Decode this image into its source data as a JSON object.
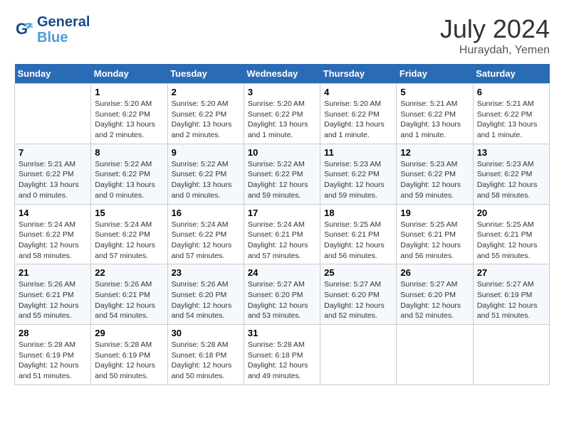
{
  "header": {
    "logo_line1": "General",
    "logo_line2": "Blue",
    "month": "July 2024",
    "location": "Huraydah, Yemen"
  },
  "columns": [
    "Sunday",
    "Monday",
    "Tuesday",
    "Wednesday",
    "Thursday",
    "Friday",
    "Saturday"
  ],
  "weeks": [
    [
      {
        "day": "",
        "info": ""
      },
      {
        "day": "1",
        "info": "Sunrise: 5:20 AM\nSunset: 6:22 PM\nDaylight: 13 hours\nand 2 minutes."
      },
      {
        "day": "2",
        "info": "Sunrise: 5:20 AM\nSunset: 6:22 PM\nDaylight: 13 hours\nand 2 minutes."
      },
      {
        "day": "3",
        "info": "Sunrise: 5:20 AM\nSunset: 6:22 PM\nDaylight: 13 hours\nand 1 minute."
      },
      {
        "day": "4",
        "info": "Sunrise: 5:20 AM\nSunset: 6:22 PM\nDaylight: 13 hours\nand 1 minute."
      },
      {
        "day": "5",
        "info": "Sunrise: 5:21 AM\nSunset: 6:22 PM\nDaylight: 13 hours\nand 1 minute."
      },
      {
        "day": "6",
        "info": "Sunrise: 5:21 AM\nSunset: 6:22 PM\nDaylight: 13 hours\nand 1 minute."
      }
    ],
    [
      {
        "day": "7",
        "info": "Sunrise: 5:21 AM\nSunset: 6:22 PM\nDaylight: 13 hours\nand 0 minutes."
      },
      {
        "day": "8",
        "info": "Sunrise: 5:22 AM\nSunset: 6:22 PM\nDaylight: 13 hours\nand 0 minutes."
      },
      {
        "day": "9",
        "info": "Sunrise: 5:22 AM\nSunset: 6:22 PM\nDaylight: 13 hours\nand 0 minutes."
      },
      {
        "day": "10",
        "info": "Sunrise: 5:22 AM\nSunset: 6:22 PM\nDaylight: 12 hours\nand 59 minutes."
      },
      {
        "day": "11",
        "info": "Sunrise: 5:23 AM\nSunset: 6:22 PM\nDaylight: 12 hours\nand 59 minutes."
      },
      {
        "day": "12",
        "info": "Sunrise: 5:23 AM\nSunset: 6:22 PM\nDaylight: 12 hours\nand 59 minutes."
      },
      {
        "day": "13",
        "info": "Sunrise: 5:23 AM\nSunset: 6:22 PM\nDaylight: 12 hours\nand 58 minutes."
      }
    ],
    [
      {
        "day": "14",
        "info": "Sunrise: 5:24 AM\nSunset: 6:22 PM\nDaylight: 12 hours\nand 58 minutes."
      },
      {
        "day": "15",
        "info": "Sunrise: 5:24 AM\nSunset: 6:22 PM\nDaylight: 12 hours\nand 57 minutes."
      },
      {
        "day": "16",
        "info": "Sunrise: 5:24 AM\nSunset: 6:22 PM\nDaylight: 12 hours\nand 57 minutes."
      },
      {
        "day": "17",
        "info": "Sunrise: 5:24 AM\nSunset: 6:21 PM\nDaylight: 12 hours\nand 57 minutes."
      },
      {
        "day": "18",
        "info": "Sunrise: 5:25 AM\nSunset: 6:21 PM\nDaylight: 12 hours\nand 56 minutes."
      },
      {
        "day": "19",
        "info": "Sunrise: 5:25 AM\nSunset: 6:21 PM\nDaylight: 12 hours\nand 56 minutes."
      },
      {
        "day": "20",
        "info": "Sunrise: 5:25 AM\nSunset: 6:21 PM\nDaylight: 12 hours\nand 55 minutes."
      }
    ],
    [
      {
        "day": "21",
        "info": "Sunrise: 5:26 AM\nSunset: 6:21 PM\nDaylight: 12 hours\nand 55 minutes."
      },
      {
        "day": "22",
        "info": "Sunrise: 5:26 AM\nSunset: 6:21 PM\nDaylight: 12 hours\nand 54 minutes."
      },
      {
        "day": "23",
        "info": "Sunrise: 5:26 AM\nSunset: 6:20 PM\nDaylight: 12 hours\nand 54 minutes."
      },
      {
        "day": "24",
        "info": "Sunrise: 5:27 AM\nSunset: 6:20 PM\nDaylight: 12 hours\nand 53 minutes."
      },
      {
        "day": "25",
        "info": "Sunrise: 5:27 AM\nSunset: 6:20 PM\nDaylight: 12 hours\nand 52 minutes."
      },
      {
        "day": "26",
        "info": "Sunrise: 5:27 AM\nSunset: 6:20 PM\nDaylight: 12 hours\nand 52 minutes."
      },
      {
        "day": "27",
        "info": "Sunrise: 5:27 AM\nSunset: 6:19 PM\nDaylight: 12 hours\nand 51 minutes."
      }
    ],
    [
      {
        "day": "28",
        "info": "Sunrise: 5:28 AM\nSunset: 6:19 PM\nDaylight: 12 hours\nand 51 minutes."
      },
      {
        "day": "29",
        "info": "Sunrise: 5:28 AM\nSunset: 6:19 PM\nDaylight: 12 hours\nand 50 minutes."
      },
      {
        "day": "30",
        "info": "Sunrise: 5:28 AM\nSunset: 6:18 PM\nDaylight: 12 hours\nand 50 minutes."
      },
      {
        "day": "31",
        "info": "Sunrise: 5:28 AM\nSunset: 6:18 PM\nDaylight: 12 hours\nand 49 minutes."
      },
      {
        "day": "",
        "info": ""
      },
      {
        "day": "",
        "info": ""
      },
      {
        "day": "",
        "info": ""
      }
    ]
  ]
}
